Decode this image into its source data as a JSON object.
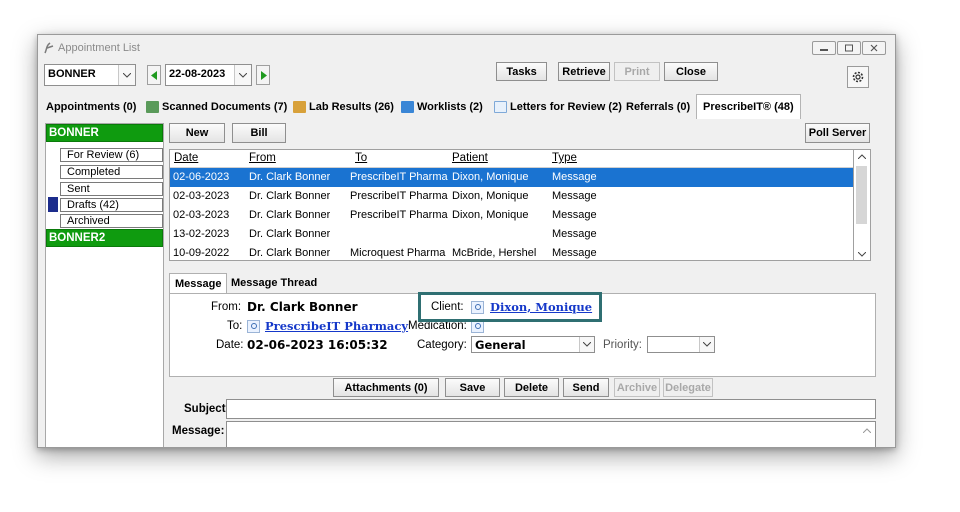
{
  "window": {
    "title": "Appointment List"
  },
  "toolbar": {
    "provider": "BONNER",
    "date": "22-08-2023",
    "tasks_label": "Tasks",
    "retrieve_label": "Retrieve",
    "print_label": "Print",
    "close_label": "Close"
  },
  "tabs": [
    {
      "label": "Appointments (0)"
    },
    {
      "label": "Scanned Documents (7)"
    },
    {
      "label": "Lab Results (26)"
    },
    {
      "label": "Worklists (2)"
    },
    {
      "label": "Letters for Review (2)"
    },
    {
      "label": "Referrals (0)"
    },
    {
      "label": "PrescribeIT® (48)"
    }
  ],
  "sidebar": {
    "group1": "BONNER",
    "items": [
      "For Review (6)",
      "Completed",
      "Sent",
      "Drafts (42)",
      "Archived"
    ],
    "group2": "BONNER2"
  },
  "actions": {
    "new_label": "New",
    "bill_label": "Bill",
    "poll_label": "Poll Server"
  },
  "table": {
    "columns": [
      "Date",
      "From",
      "To",
      "Patient",
      "Type"
    ],
    "rows": [
      {
        "date": "02-06-2023",
        "from": "Dr. Clark Bonner",
        "to": "PrescribeIT Pharma",
        "patient": "Dixon, Monique",
        "type": "Message"
      },
      {
        "date": "02-03-2023",
        "from": "Dr. Clark Bonner",
        "to": "PrescribeIT Pharma",
        "patient": "Dixon, Monique",
        "type": "Message"
      },
      {
        "date": "02-03-2023",
        "from": "Dr. Clark Bonner",
        "to": "PrescribeIT Pharma",
        "patient": "Dixon, Monique",
        "type": "Message"
      },
      {
        "date": "13-02-2023",
        "from": "Dr. Clark Bonner",
        "to": "",
        "patient": "",
        "type": "Message"
      },
      {
        "date": "10-09-2022",
        "from": "Dr. Clark Bonner",
        "to": "Microquest Pharma",
        "patient": "McBride, Hershel",
        "type": "Message"
      }
    ]
  },
  "message_tabs": [
    "Message",
    "Message Thread"
  ],
  "message": {
    "from_label": "From:",
    "from_value": "Dr. Clark Bonner",
    "to_label": "To:",
    "to_value": "PrescribeIT Pharmacy",
    "date_label": "Date:",
    "date_value": "02-06-2023 16:05:32",
    "client_label": "Client:",
    "client_value": "Dixon, Monique",
    "medication_label": "Medication:",
    "category_label": "Category:",
    "category_value": "General",
    "priority_label": "Priority:",
    "priority_value": ""
  },
  "message_actions": [
    "Attachments (0)",
    "Save",
    "Delete",
    "Send",
    "Archive",
    "Delegate"
  ],
  "compose": {
    "subject_label": "Subject:",
    "message_label": "Message:",
    "subject_value": "",
    "message_value": ""
  },
  "colors": {
    "folder_green": "#0f9b0f",
    "selection_blue": "#1a73d1",
    "highlight_teal": "#2f6f72",
    "link_blue": "#1538c9"
  }
}
